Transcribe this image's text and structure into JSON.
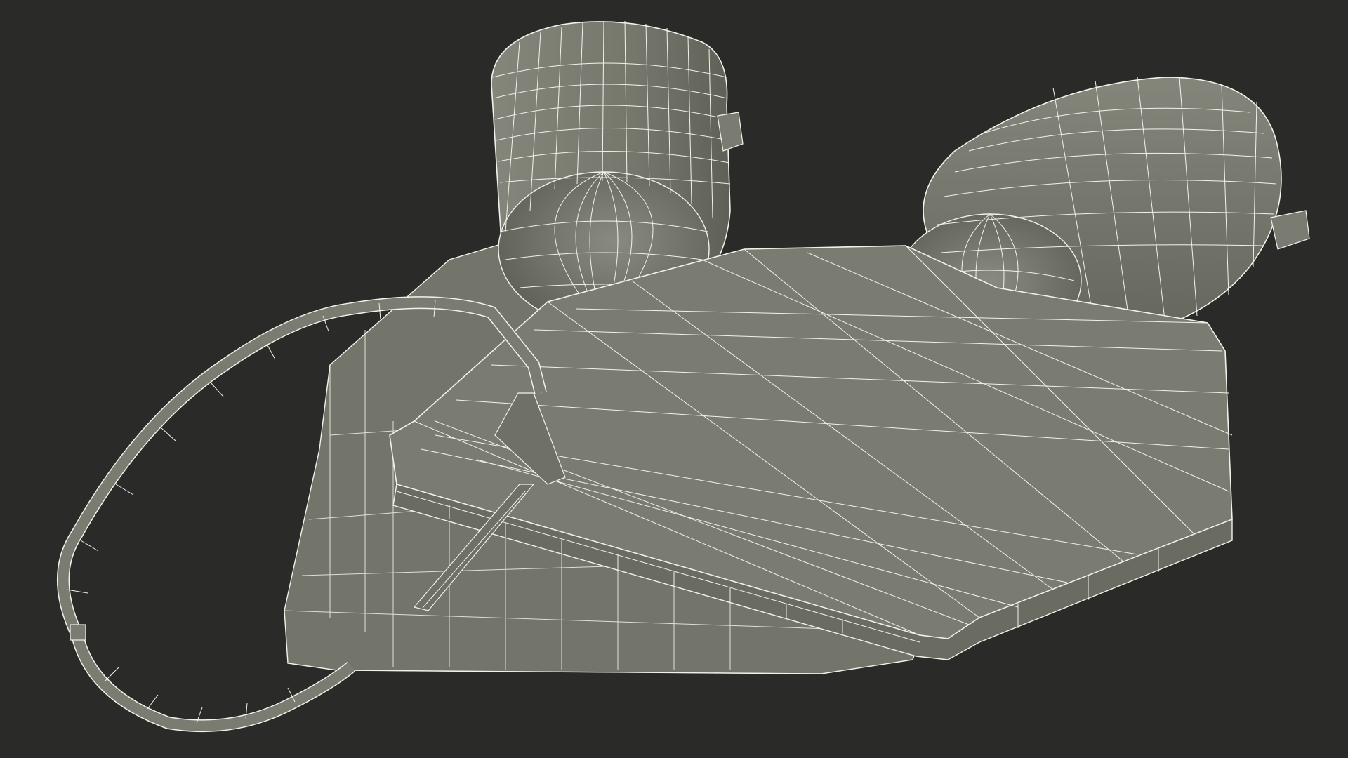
{
  "scene": {
    "subject": "wireframe-mesh-render",
    "colors": {
      "background": "#2a2a29",
      "surface": "#7b7c71",
      "surface_light": "#8a8b80",
      "surface_dark": "#5f6057",
      "wire": "#f2f2ea"
    }
  }
}
